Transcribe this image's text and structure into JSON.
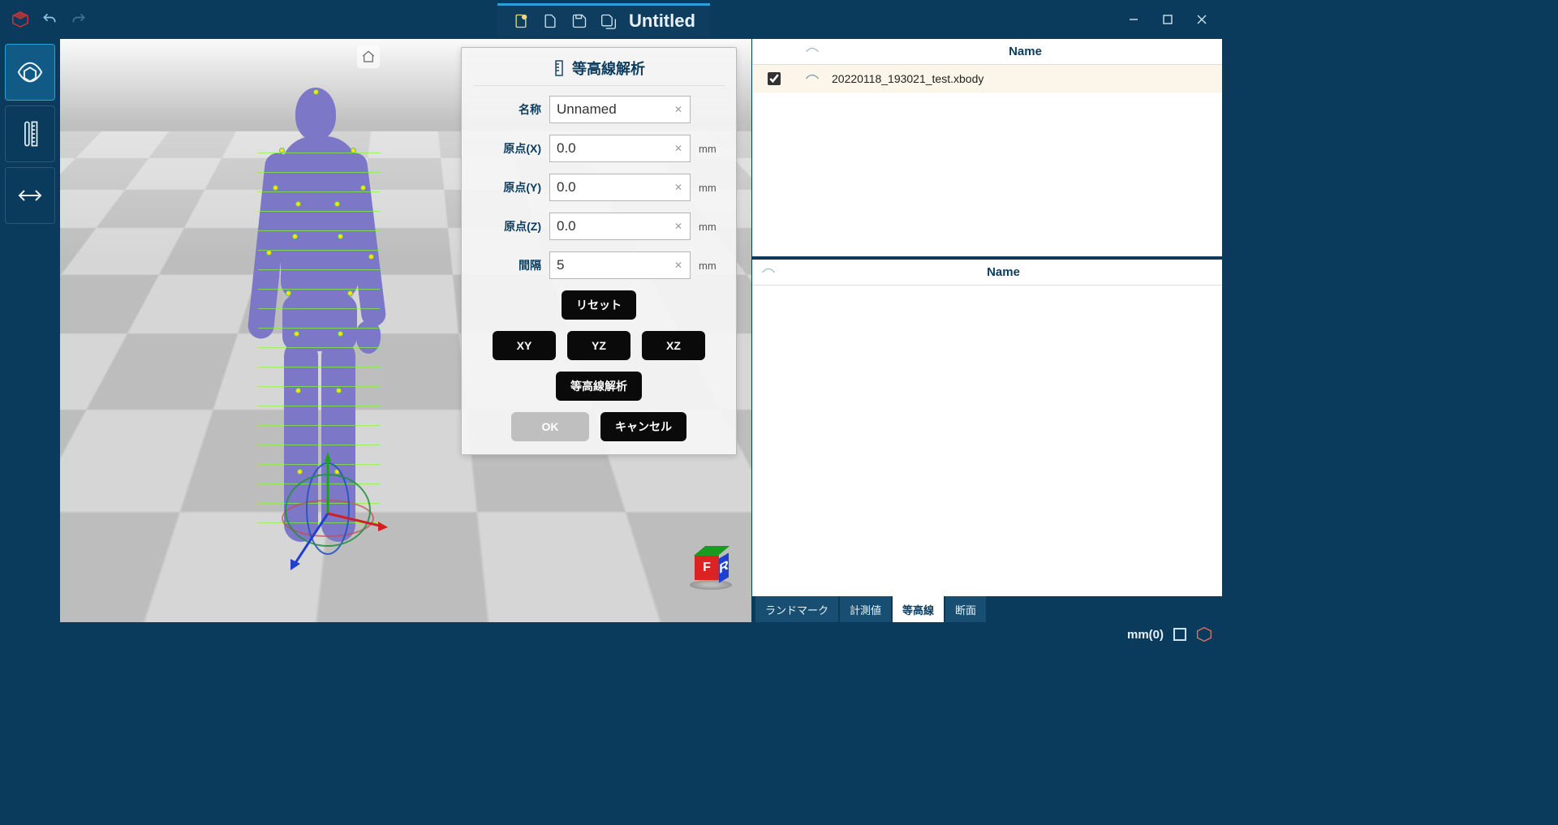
{
  "title": "Untitled",
  "panel": {
    "title": "等高線解析",
    "fields": {
      "name_label": "名称",
      "name_value": "Unnamed",
      "ox_label": "原点(X)",
      "ox_value": "0.0",
      "oy_label": "原点(Y)",
      "oy_value": "0.0",
      "oz_label": "原点(Z)",
      "oz_value": "0.0",
      "interval_label": "間隔",
      "interval_value": "5",
      "unit": "mm"
    },
    "buttons": {
      "reset": "リセット",
      "xy": "XY",
      "yz": "YZ",
      "xz": "XZ",
      "analyze": "等高線解析",
      "ok": "OK",
      "cancel": "キャンセル"
    }
  },
  "list_top": {
    "header": "Name",
    "items": [
      {
        "checked": true,
        "name": "20220118_193021_test.xbody"
      }
    ]
  },
  "list_bottom": {
    "header": "Name"
  },
  "tabs": {
    "landmark": "ランドマーク",
    "measure": "計測値",
    "contour": "等高線",
    "section": "断面"
  },
  "status": {
    "units": "mm(0)"
  }
}
